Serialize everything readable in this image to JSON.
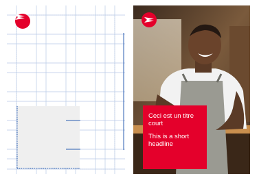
{
  "brand": {
    "logo_icon": "canada-post-eagle-icon",
    "accent_color": "#e4002b",
    "grid_color": "#b7c9e6",
    "guide_color": "#2a5db0",
    "placeholder_fill": "#efefef"
  },
  "photo_card": {
    "headline_fr": "Ceci est un titre court",
    "headline_en": "This is a short headline"
  }
}
